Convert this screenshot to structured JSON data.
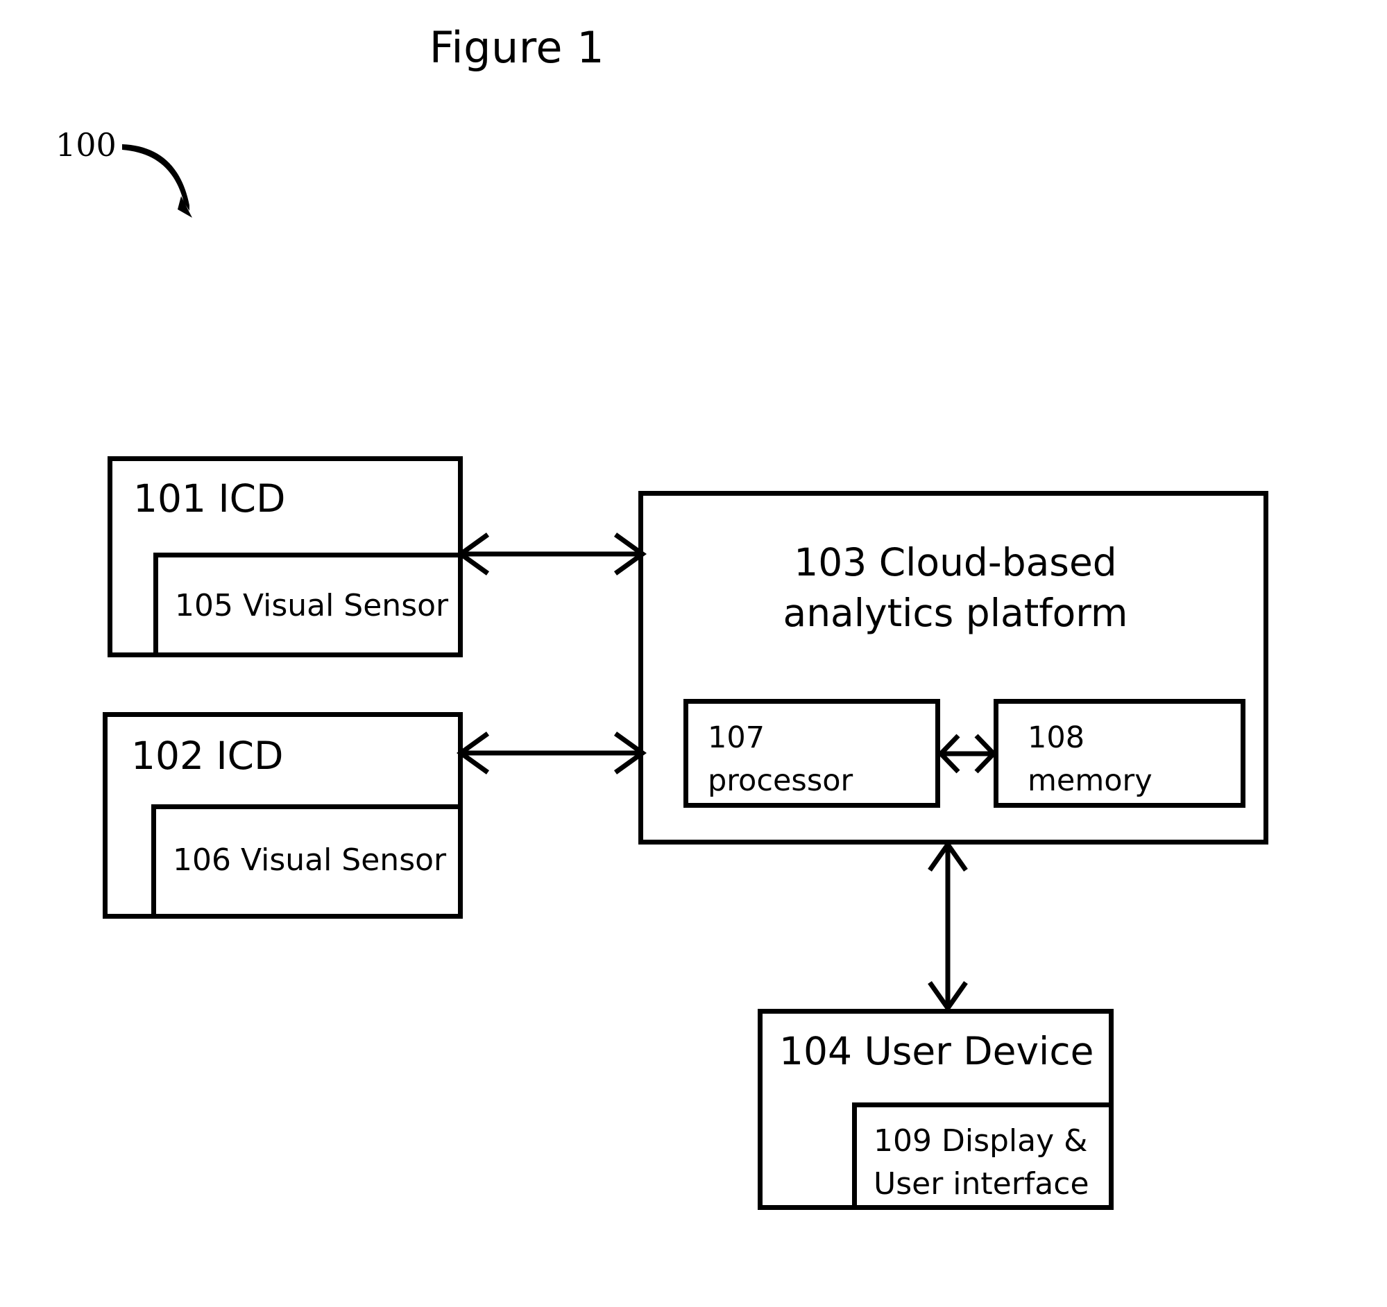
{
  "figure": {
    "title": "Figure 1",
    "system_ref": "100"
  },
  "boxes": {
    "icd1": {
      "label": "101 ICD",
      "sensor": {
        "label": "105 Visual Sensor"
      }
    },
    "icd2": {
      "label": "102 ICD",
      "sensor": {
        "label": "106 Visual Sensor"
      }
    },
    "cloud": {
      "label_line1": "103 Cloud-based",
      "label_line2": "analytics platform",
      "processor": {
        "label_line1": "107",
        "label_line2": "processor"
      },
      "memory": {
        "label_line1": "108",
        "label_line2": "memory"
      }
    },
    "user_device": {
      "label": "104 User Device",
      "display": {
        "label_line1": "109 Display &",
        "label_line2": "User interface"
      }
    }
  },
  "connectors": {
    "icd1_to_cloud": {
      "name": "icd1-cloud-bidirectional-arrow",
      "type": "double-headed-horizontal"
    },
    "icd2_to_cloud": {
      "name": "icd2-cloud-bidirectional-arrow",
      "type": "double-headed-horizontal"
    },
    "processor_to_memory": {
      "name": "processor-memory-bidirectional-arrow",
      "type": "double-headed-horizontal"
    },
    "cloud_to_user_device": {
      "name": "cloud-user-device-bidirectional-arrow",
      "type": "double-headed-vertical"
    },
    "system_pointer": {
      "name": "system-reference-curved-arrow",
      "type": "curved-tapered"
    }
  },
  "colors": {
    "stroke": "#000000",
    "background": "#ffffff"
  }
}
